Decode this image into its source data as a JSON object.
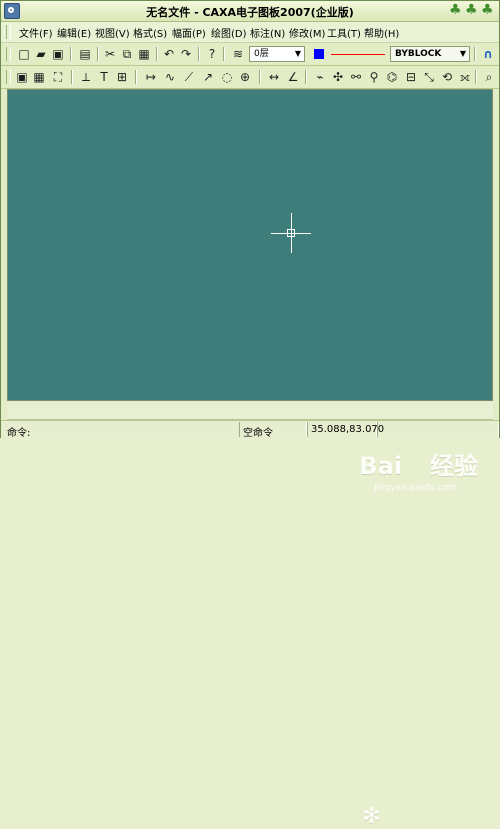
{
  "window": {
    "title": "无名文件 - CAXA电子图板2007(企业版)",
    "accent": "#3f7d7b"
  },
  "menu": [
    {
      "label": "文件(F)"
    },
    {
      "label": "编辑(E)"
    },
    {
      "label": "视图(V)"
    },
    {
      "label": "格式(S)"
    },
    {
      "label": "幅面(P)"
    },
    {
      "label": "绘图(D)"
    },
    {
      "label": "标注(N)"
    },
    {
      "label": "修改(M)"
    },
    {
      "label": "工具(T)"
    },
    {
      "label": "帮助(H)"
    }
  ],
  "toolbar": {
    "layer": "0层",
    "linetype": "BYBLOCK",
    "color": "#0000ff",
    "line_color": "#ff0000"
  },
  "watermark": {
    "brand": "Bai",
    "brand2": "经验",
    "url": "jingyan.baidu.com"
  },
  "status": {
    "command_label": "命令:",
    "empty_command": "空命令",
    "coordinates": "35.088,83.070"
  },
  "icons": [
    "new-file-icon",
    "open-folder-icon",
    "save-icon",
    "print-icon",
    "cut-icon",
    "copy-icon",
    "paste-icon",
    "undo-icon",
    "redo-icon",
    "help-icon",
    "layer-icon",
    "color-icon",
    "measure-icon"
  ]
}
